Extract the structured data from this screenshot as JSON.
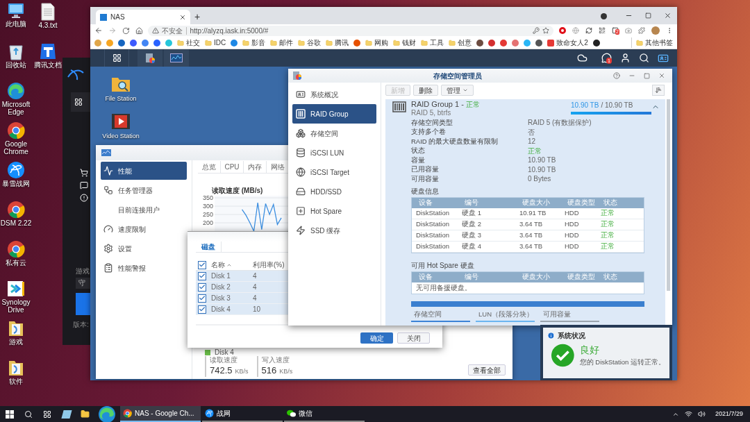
{
  "desktop": {
    "columns": [
      {
        "icons": [
          {
            "label": "此电脑",
            "kind": "pc"
          },
          {
            "label": "回收站",
            "kind": "recycle"
          },
          {
            "label": "Microsoft Edge",
            "kind": "edge"
          },
          {
            "label": "Google Chrome",
            "kind": "chrome"
          },
          {
            "label": "暴雪战网",
            "kind": "battlenet"
          },
          {
            "label": "DSM 2.22",
            "kind": "chrome"
          },
          {
            "label": "私有云",
            "kind": "chrome"
          },
          {
            "label": "Synology Drive",
            "kind": "drive"
          },
          {
            "label": "游戏",
            "kind": "folder"
          },
          {
            "label": "软件",
            "kind": "folder"
          }
        ]
      },
      {
        "icons": [
          {
            "label": "4.3.txt",
            "kind": "file"
          },
          {
            "label": "腾讯文档",
            "kind": "doc"
          }
        ]
      }
    ]
  },
  "background_app": {
    "section_label": "游戏",
    "field_value": "守",
    "version_label": "版本:"
  },
  "browser": {
    "tab": {
      "title": "NAS"
    },
    "new_tab": "+",
    "address": {
      "warning": "不安全",
      "url": "http://alyzq.iask.in:5000/#"
    },
    "extension_badge": "2",
    "bookmarks": [
      {
        "kind": "site"
      },
      {
        "kind": "site"
      },
      {
        "kind": "site"
      },
      {
        "kind": "site"
      },
      {
        "kind": "site"
      },
      {
        "kind": "site"
      },
      {
        "kind": "site"
      },
      {
        "kind": "folder",
        "label": "社交"
      },
      {
        "kind": "folder",
        "label": "IDC"
      },
      {
        "kind": "site"
      },
      {
        "kind": "folder",
        "label": "影音"
      },
      {
        "kind": "folder",
        "label": "邮件"
      },
      {
        "kind": "folder",
        "label": "谷歌"
      },
      {
        "kind": "folder",
        "label": "腾讯"
      },
      {
        "kind": "site"
      },
      {
        "kind": "folder",
        "label": "网购"
      },
      {
        "kind": "folder",
        "label": "钱财"
      },
      {
        "kind": "folder",
        "label": "工具"
      },
      {
        "kind": "folder",
        "label": "创意"
      },
      {
        "kind": "site"
      },
      {
        "kind": "site"
      },
      {
        "kind": "site"
      },
      {
        "kind": "site"
      },
      {
        "kind": "site"
      },
      {
        "kind": "site"
      },
      {
        "kind": "site",
        "label": "致命女人2"
      },
      {
        "kind": "site"
      }
    ],
    "other_bookmarks": "其他书签"
  },
  "dsm": {
    "notification_count": "1",
    "desktop_apps": [
      {
        "label": "File Station",
        "kind": "files"
      },
      {
        "label": "Video Station",
        "kind": "video"
      }
    ],
    "resource_monitor": {
      "sidebar": [
        {
          "label": "性能",
          "kind": "performance",
          "selected": true
        },
        {
          "label": "任务管理器",
          "kind": "tasks",
          "selected": false,
          "children": [
            {
              "label": "目前连接用户",
              "selected": false
            }
          ]
        },
        {
          "label": "速度限制",
          "kind": "speed",
          "selected": false
        },
        {
          "label": "设置",
          "kind": "settings",
          "selected": false
        },
        {
          "label": "性能警报",
          "kind": "alerts",
          "selected": false
        }
      ],
      "tabs": [
        {
          "label": "总览",
          "selected": false
        },
        {
          "label": "CPU",
          "selected": false
        },
        {
          "label": "内存",
          "selected": false
        },
        {
          "label": "网络",
          "selected": false
        }
      ],
      "chart_data": {
        "type": "line",
        "title": "读取速度 (MB/s)",
        "ylim": [
          150,
          350
        ],
        "yticks": [
          200,
          250,
          300,
          350
        ],
        "grid": true,
        "values": [
          null,
          null,
          null,
          null,
          null,
          null,
          null,
          280,
          245,
          200,
          150,
          320,
          160,
          315,
          250,
          310,
          190,
          230,
          null,
          null,
          null,
          null,
          null,
          null
        ]
      },
      "legend": {
        "label": "Disk 4",
        "color": "#6cc04a"
      },
      "stats": [
        {
          "label": "读取速度",
          "value": "742.5",
          "unit": "KB/s"
        },
        {
          "label": "写入速度",
          "value": "516",
          "unit": "KB/s"
        }
      ],
      "view_all_button": "查看全部"
    },
    "disk_dialog": {
      "tabs": [
        {
          "label": "磁盘",
          "selected": true
        }
      ],
      "columns": [
        "名称",
        "利用率(%)"
      ],
      "header_checked": true,
      "rows": [
        {
          "name": "Disk 1",
          "usage": "4",
          "checked": true
        },
        {
          "name": "Disk 2",
          "usage": "4",
          "checked": true
        },
        {
          "name": "Disk 3",
          "usage": "4",
          "checked": true
        },
        {
          "name": "Disk 4",
          "usage": "10",
          "checked": true
        }
      ],
      "buttons": [
        {
          "label": "确定",
          "kind": "primary"
        },
        {
          "label": "关闭",
          "kind": "secondary"
        }
      ]
    },
    "storage_manager": {
      "title": "存储空间管理员",
      "sidebar": [
        {
          "label": "系统概况",
          "kind": "overview",
          "selected": false
        },
        {
          "label": "RAID Group",
          "kind": "raid",
          "selected": true
        },
        {
          "label": "存储空间",
          "kind": "storage",
          "selected": false
        },
        {
          "label": "iSCSI LUN",
          "kind": "lun",
          "selected": false
        },
        {
          "label": "iSCSI Target",
          "kind": "target",
          "selected": false
        },
        {
          "label": "HDD/SSD",
          "kind": "hdd",
          "selected": false
        },
        {
          "label": "Hot Spare",
          "kind": "hotspare",
          "selected": false
        },
        {
          "label": "SSD 缓存",
          "kind": "ssd",
          "selected": false
        }
      ],
      "toolbar": [
        {
          "label": "新增",
          "disabled": true,
          "kind": "button"
        },
        {
          "label": "删除",
          "disabled": false,
          "kind": "button"
        },
        {
          "label": "管理",
          "disabled": false,
          "kind": "menu"
        }
      ],
      "raid_group": {
        "title": "RAID Group 1 -",
        "status": "正常",
        "subtitle": "RAID 5, btrfs",
        "used": "10.90 TB",
        "total": "/ 10.90 TB",
        "level": 1,
        "expanded": true,
        "properties": [
          {
            "label": "存储空间类型",
            "value": "RAID 5 (有数据保护)",
            "kind": "text"
          },
          {
            "label": "支持多个卷",
            "value": "否",
            "kind": "text"
          },
          {
            "label": "RAID 的最大硬盘数量有限制",
            "value": "12",
            "kind": "text"
          },
          {
            "label": "状态",
            "value": "正常",
            "kind": "status"
          },
          {
            "label": "容量",
            "value": "10.90 TB",
            "kind": "text"
          },
          {
            "label": "已用容量",
            "value": "10.90 TB",
            "kind": "text"
          },
          {
            "label": "可用容量",
            "value": "0 Bytes",
            "kind": "text"
          }
        ],
        "disk_info_title": "硬盘信息",
        "columns": [
          "设备",
          "编号",
          "硬盘大小",
          "硬盘类型",
          "状态"
        ],
        "disks": [
          {
            "device": "DiskStation",
            "number": "硬盘 1",
            "size": "10.91 TB",
            "type": "HDD",
            "status": "正常"
          },
          {
            "device": "DiskStation",
            "number": "硬盘 2",
            "size": "3.64 TB",
            "type": "HDD",
            "status": "正常"
          },
          {
            "device": "DiskStation",
            "number": "硬盘 3",
            "size": "3.64 TB",
            "type": "HDD",
            "status": "正常"
          },
          {
            "device": "DiskStation",
            "number": "硬盘 4",
            "size": "3.64 TB",
            "type": "HDD",
            "status": "正常"
          }
        ],
        "hot_spare_title": "可用 Hot Spare 硬盘",
        "hot_spare_columns": [
          "设备",
          "编号",
          "硬盘大小",
          "硬盘类型",
          "状态"
        ],
        "hot_spare_empty": "无可用备援硬盘。",
        "usage_legend": [
          {
            "label": "存储空间",
            "color": "#3b82d6"
          },
          {
            "label": "LUN（段落分块）",
            "color": "#6cb6f0"
          },
          {
            "label": "可用容量",
            "color": "#9aa4ad"
          }
        ]
      }
    },
    "status_widget": {
      "title": "系统状况",
      "status": "良好",
      "message": "您的 DiskStation 运转正常。"
    }
  },
  "taskbar": {
    "apps": [
      {
        "label": "NAS - Google Ch...",
        "kind": "chrome",
        "selected": true
      },
      {
        "label": "战网",
        "kind": "battlenet",
        "selected": false
      },
      {
        "label": "微信",
        "kind": "wechat",
        "selected": false
      }
    ],
    "date": "2021/7/29"
  }
}
